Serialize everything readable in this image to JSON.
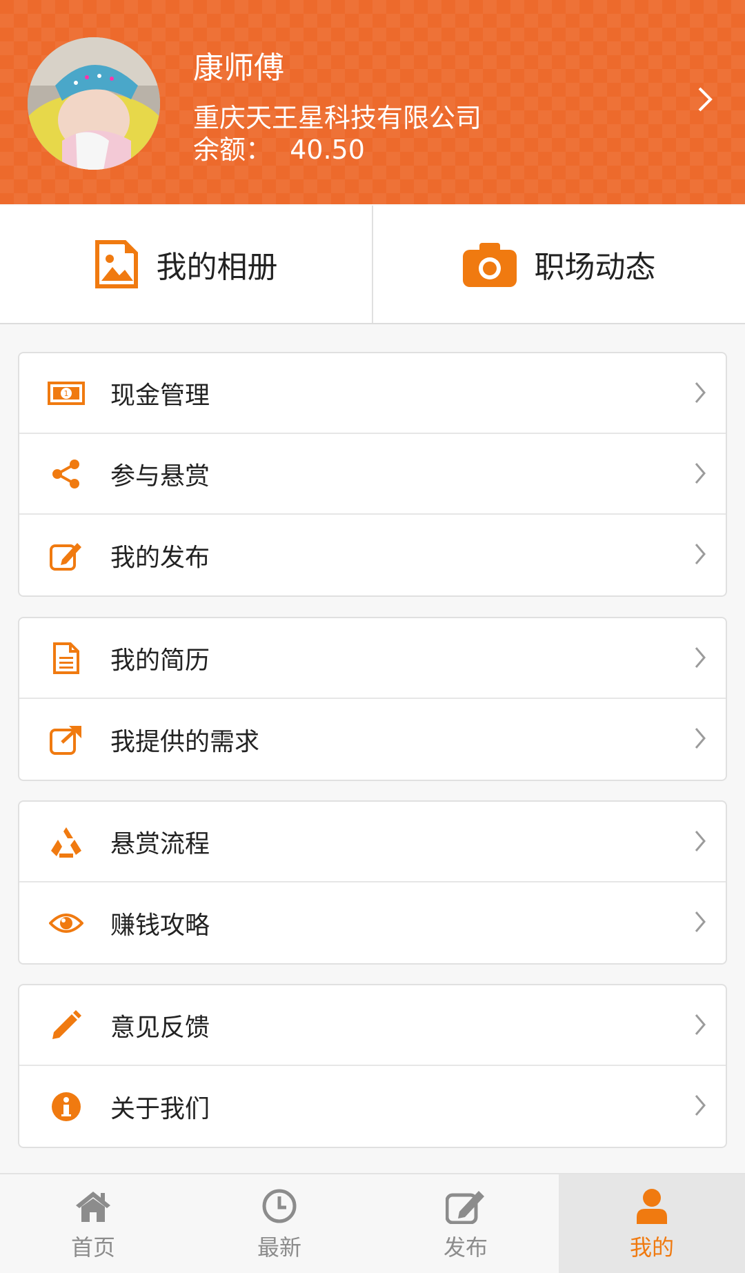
{
  "profile": {
    "name": "康师傅",
    "company": "重庆天王星科技有限公司",
    "balance_label": "余额：",
    "balance_value": "40.50"
  },
  "quick_actions": [
    {
      "label": "我的相册",
      "icon": "photo-icon"
    },
    {
      "label": "职场动态",
      "icon": "camera-icon"
    }
  ],
  "menu_groups": [
    [
      {
        "label": "现金管理",
        "icon": "money-icon"
      },
      {
        "label": "参与悬赏",
        "icon": "share-icon"
      },
      {
        "label": "我的发布",
        "icon": "edit-icon"
      }
    ],
    [
      {
        "label": "我的简历",
        "icon": "document-icon"
      },
      {
        "label": "我提供的需求",
        "icon": "external-link-icon"
      }
    ],
    [
      {
        "label": "悬赏流程",
        "icon": "recycle-icon"
      },
      {
        "label": "赚钱攻略",
        "icon": "eye-icon"
      }
    ],
    [
      {
        "label": "意见反馈",
        "icon": "pencil-icon"
      },
      {
        "label": "关于我们",
        "icon": "info-icon"
      }
    ]
  ],
  "bottom_nav": [
    {
      "label": "首页",
      "icon": "home-icon"
    },
    {
      "label": "最新",
      "icon": "clock-icon"
    },
    {
      "label": "发布",
      "icon": "edit-icon"
    },
    {
      "label": "我的",
      "icon": "user-icon",
      "active": true
    }
  ],
  "colors": {
    "accent": "#f07a10",
    "header": "#ed6a2c",
    "nav_inactive": "#8c8c8c"
  }
}
